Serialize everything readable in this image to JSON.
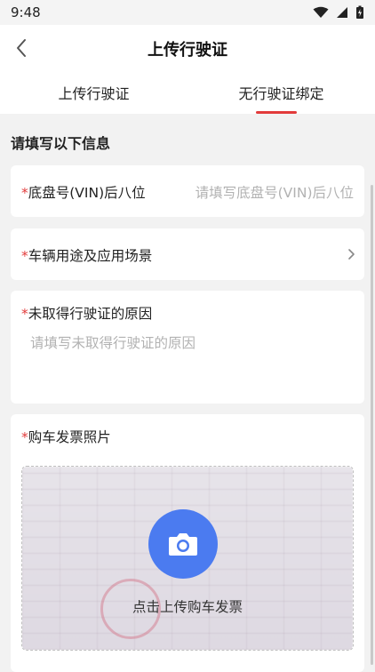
{
  "status_bar": {
    "time": "9:48"
  },
  "header": {
    "title": "上传行驶证"
  },
  "tabs": [
    {
      "label": "上传行驶证"
    },
    {
      "label": "无行驶证绑定"
    }
  ],
  "form": {
    "section_title": "请填写以下信息",
    "required_mark": "*",
    "vin": {
      "label": "底盘号(VIN)后八位",
      "placeholder": "请填写底盘号(VIN)后八位"
    },
    "usage": {
      "label": "车辆用途及应用场景"
    },
    "reason": {
      "label": "未取得行驶证的原因",
      "placeholder": "请填写未取得行驶证的原因"
    },
    "invoice": {
      "label": "购车发票照片",
      "upload_text": "点击上传购车发票"
    }
  },
  "colors": {
    "accent": "#e23b3b",
    "camera": "#4b7bf0"
  }
}
